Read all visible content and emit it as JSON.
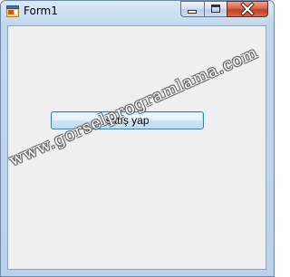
{
  "window": {
    "title": "Form1"
  },
  "form": {
    "button_label": "satış yap"
  },
  "watermark": {
    "text": "www.gorselprogramlama.com"
  },
  "icons": {
    "app": "form-app-icon",
    "minimize": "minimize-icon",
    "maximize": "maximize-icon",
    "close": "close-icon"
  },
  "colors": {
    "client_bg": "#f0f0f0",
    "close_button": "#c2401f",
    "button_border": "#3c7fb1"
  }
}
